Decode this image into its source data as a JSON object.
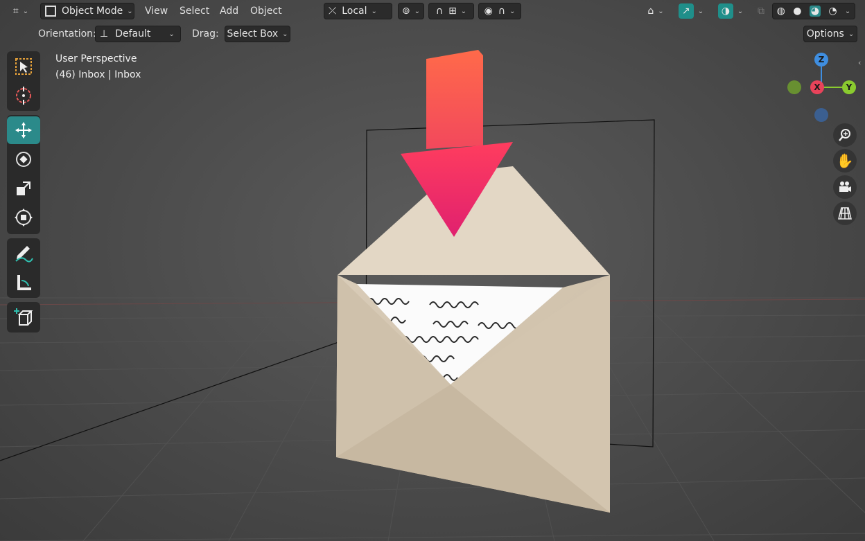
{
  "header": {
    "mode_label": "Object Mode",
    "menus": [
      "View",
      "Select",
      "Add",
      "Object"
    ],
    "transform_orientation": "Local",
    "options_label": "Options"
  },
  "tool_settings": {
    "orientation_label": "Orientation:",
    "orientation_value": "Default",
    "drag_label": "Drag:",
    "drag_value": "Select Box"
  },
  "viewport_overlay": {
    "view_name": "User Perspective",
    "collection_info": "(46) Inbox | Inbox"
  },
  "navigation_gizmo": {
    "axes": [
      "Z",
      "X",
      "Y"
    ]
  },
  "toolbar": {
    "tools": [
      "select-box",
      "cursor",
      "move",
      "rotate",
      "scale",
      "transform",
      "annotate",
      "measure",
      "add-cube"
    ],
    "active_tool": "move"
  },
  "colors": {
    "accent": "#2b8a8a",
    "x_axis": "#e8435a",
    "y_axis": "#8acb2f",
    "z_axis": "#3f8ee0",
    "arrow": "#ee2f6a",
    "envelope": "#d8cbb6"
  }
}
